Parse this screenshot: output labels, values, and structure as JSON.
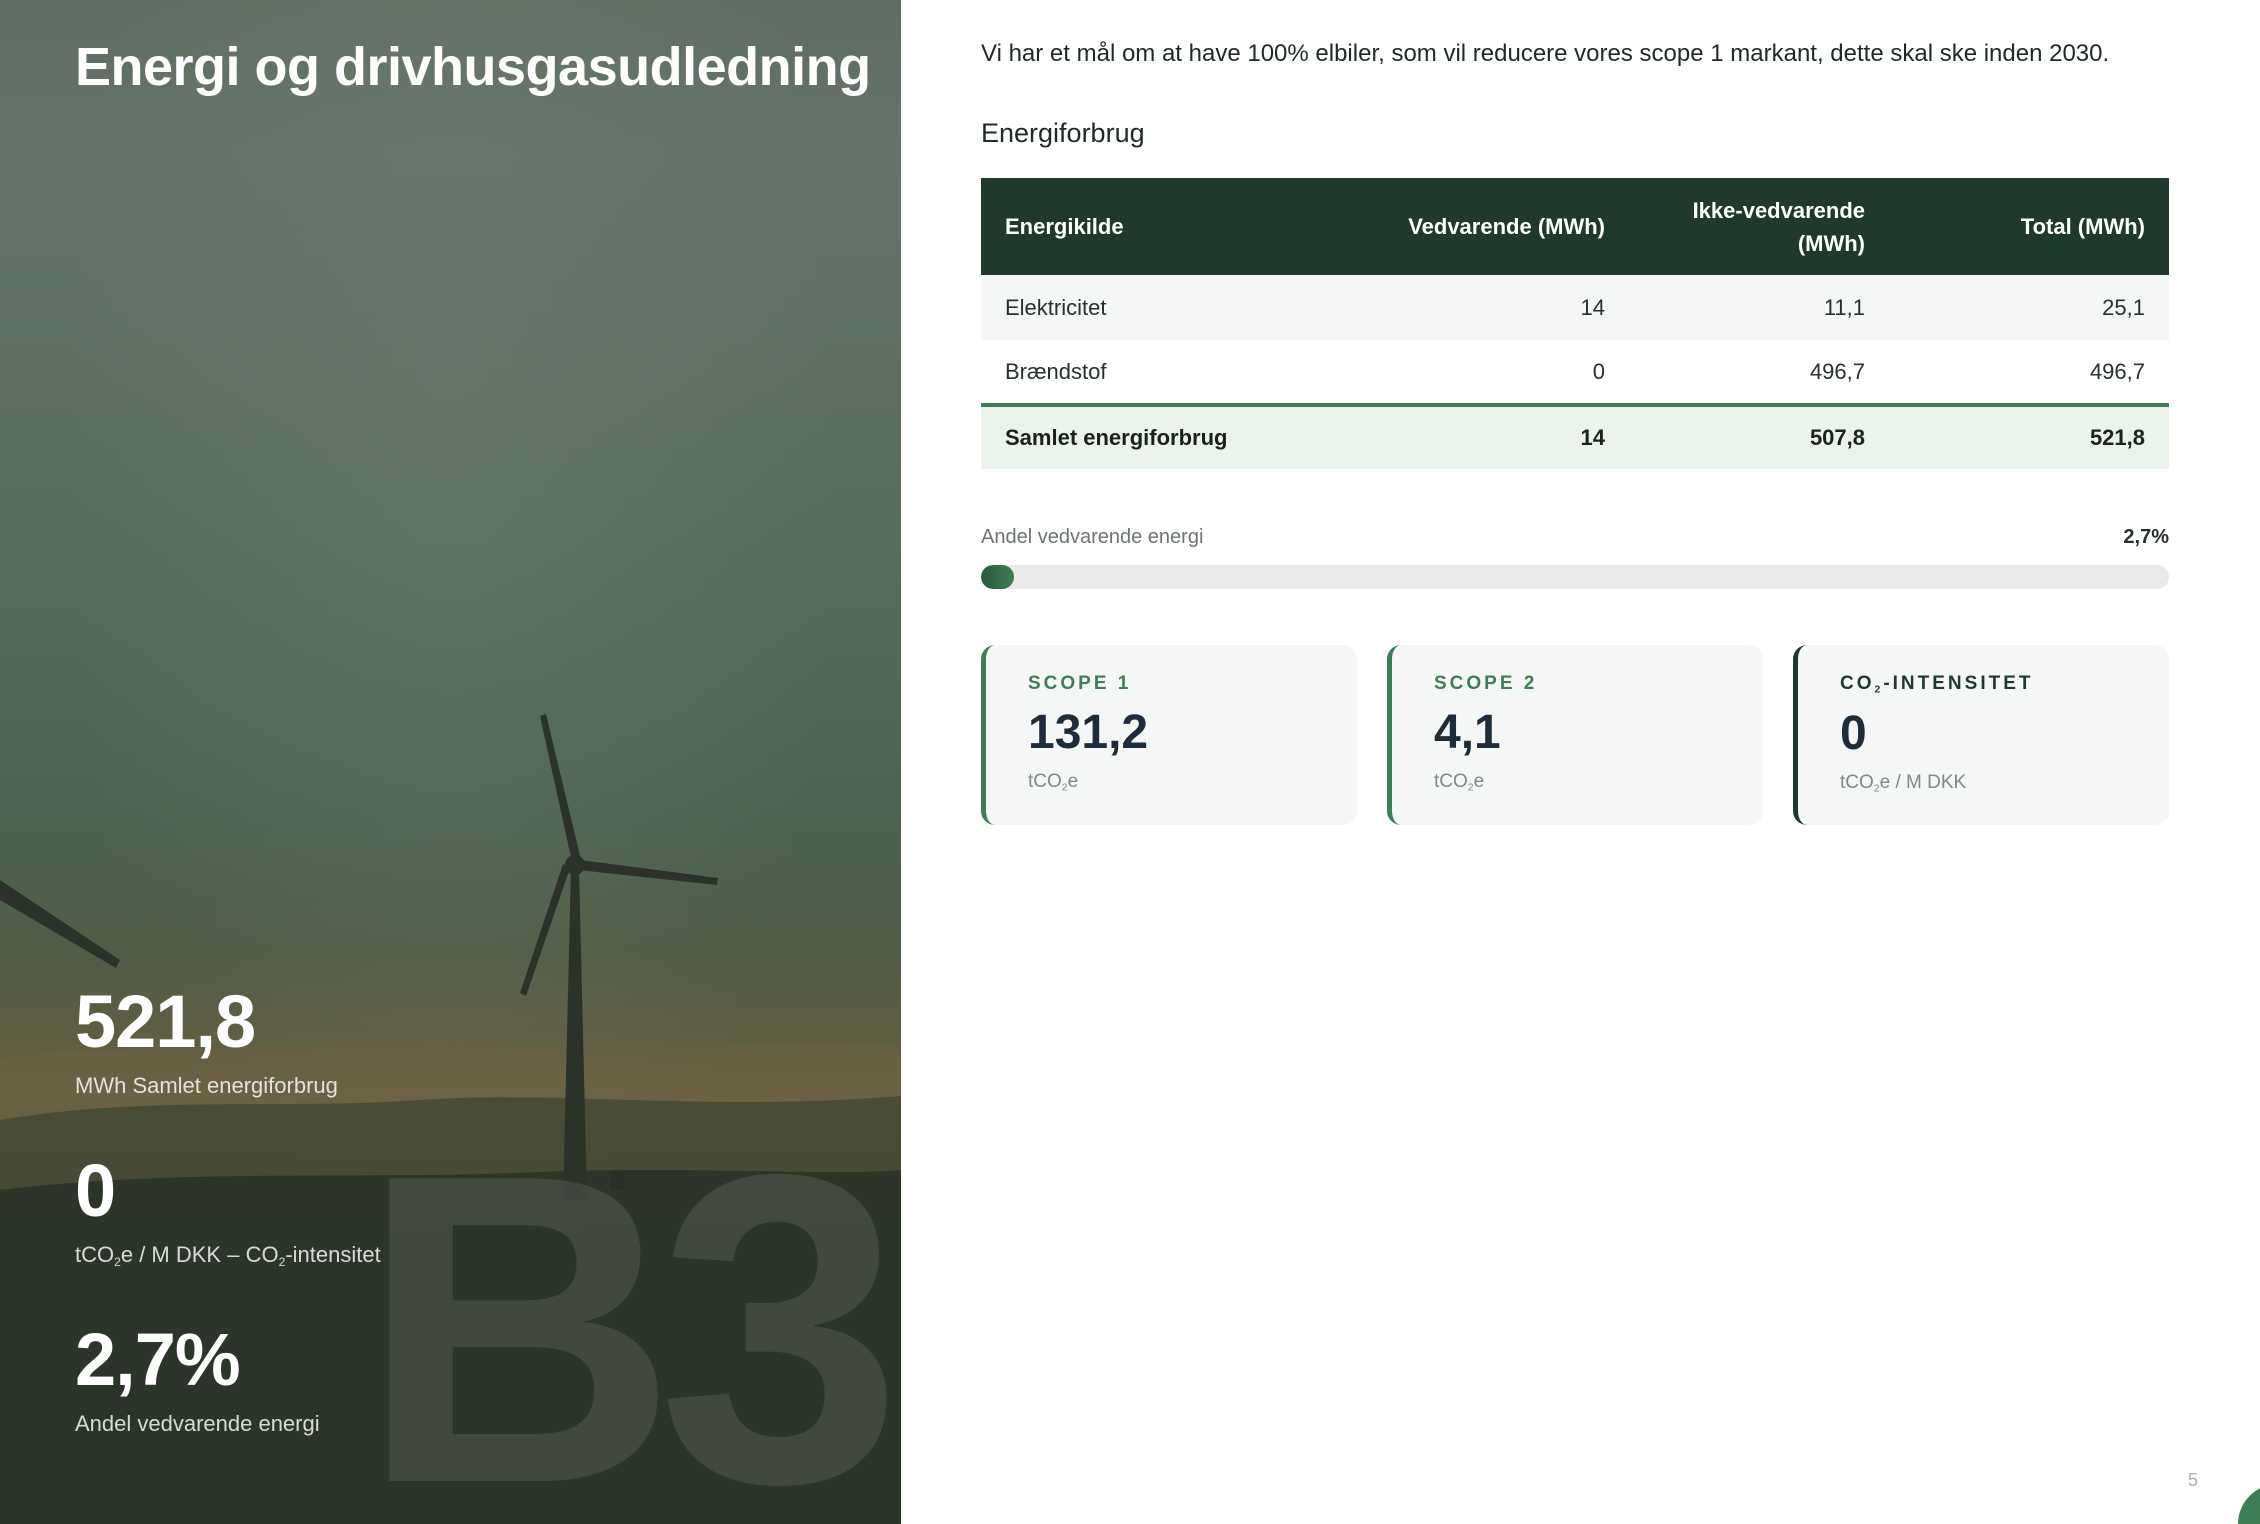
{
  "hero": {
    "title": "Energi og drivhusgasudledning",
    "watermark": "B3",
    "stats": [
      {
        "value": "521,8",
        "label": "MWh Samlet energiforbrug"
      },
      {
        "value": "0",
        "label_parts": [
          "tCO",
          "2",
          "e / M DKK – CO",
          "2",
          "-intensitet"
        ]
      },
      {
        "value": "2,7%",
        "label": "Andel vedvarende energi"
      }
    ]
  },
  "intro": "Vi har et mål om at have 100% elbiler, som vil reducere vores scope 1 markant, dette skal ske inden 2030.",
  "energy_section": {
    "heading": "Energiforbrug",
    "columns": [
      "Energikilde",
      "Vedvarende (MWh)",
      "Ikke-vedvarende (MWh)",
      "Total (MWh)"
    ],
    "rows": [
      [
        "Elektricitet",
        "14",
        "11,1",
        "25,1"
      ],
      [
        "Brændstof",
        "0",
        "496,7",
        "496,7"
      ]
    ],
    "total": [
      "Samlet energiforbrug",
      "14",
      "507,8",
      "521,8"
    ]
  },
  "renewable_share": {
    "label": "Andel vedvarende energi",
    "value_text": "2,7%",
    "fraction": 0.027
  },
  "cards": [
    {
      "label": "SCOPE 1",
      "value": "131,2",
      "unit_parts": [
        "tCO",
        "2",
        "e"
      ]
    },
    {
      "label": "SCOPE 2",
      "value": "4,1",
      "unit_parts": [
        "tCO",
        "2",
        "e"
      ]
    },
    {
      "label_parts": [
        "CO",
        "2",
        "-INTENSITET"
      ],
      "value": "0",
      "unit_parts": [
        "tCO",
        "2",
        "e / M DKK"
      ]
    }
  ],
  "page_number": "5",
  "colors": {
    "accent_green": "#3f7d55",
    "dark_green": "#1f3a2c",
    "table_total_bg": "#eaf3ec"
  }
}
